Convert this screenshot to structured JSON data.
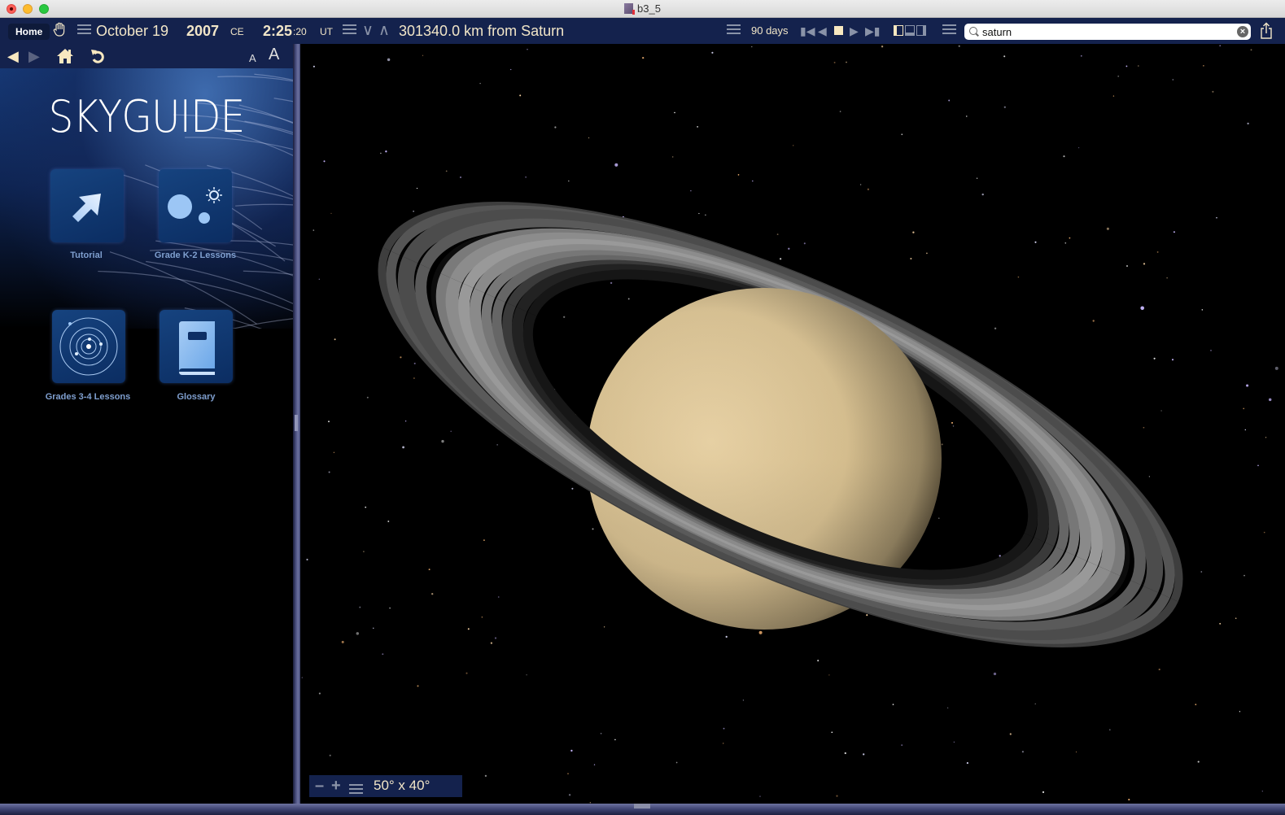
{
  "window": {
    "title": "b3_5"
  },
  "toolbar": {
    "home_label": "Home",
    "date": "October 19",
    "year": "2007",
    "era": "CE",
    "time_hm": "2:25",
    "time_sec": ":20",
    "timezone": "UT",
    "distance_readout": "301340.0 km from Saturn",
    "time_step": "90 days"
  },
  "search": {
    "value": "saturn",
    "placeholder": ""
  },
  "sidebar": {
    "brand": "SKYGUIDE",
    "font_small": "A",
    "font_large": "A",
    "tiles": [
      {
        "label": "Tutorial",
        "icon": "arrow-icon"
      },
      {
        "label": "Grade K-2 Lessons",
        "icon": "planets-sun-icon"
      },
      {
        "label": "Grades 3-4 Lessons",
        "icon": "orbits-icon"
      },
      {
        "label": "Glossary",
        "icon": "book-icon"
      }
    ]
  },
  "view": {
    "object": "Saturn",
    "field_of_view": "50° x 40°"
  },
  "colors": {
    "toolbar_bg": "#14224d",
    "toolbar_text": "#f2e6c8",
    "icon_grey": "#8a93a8",
    "tile_label": "#7f9fcf"
  }
}
